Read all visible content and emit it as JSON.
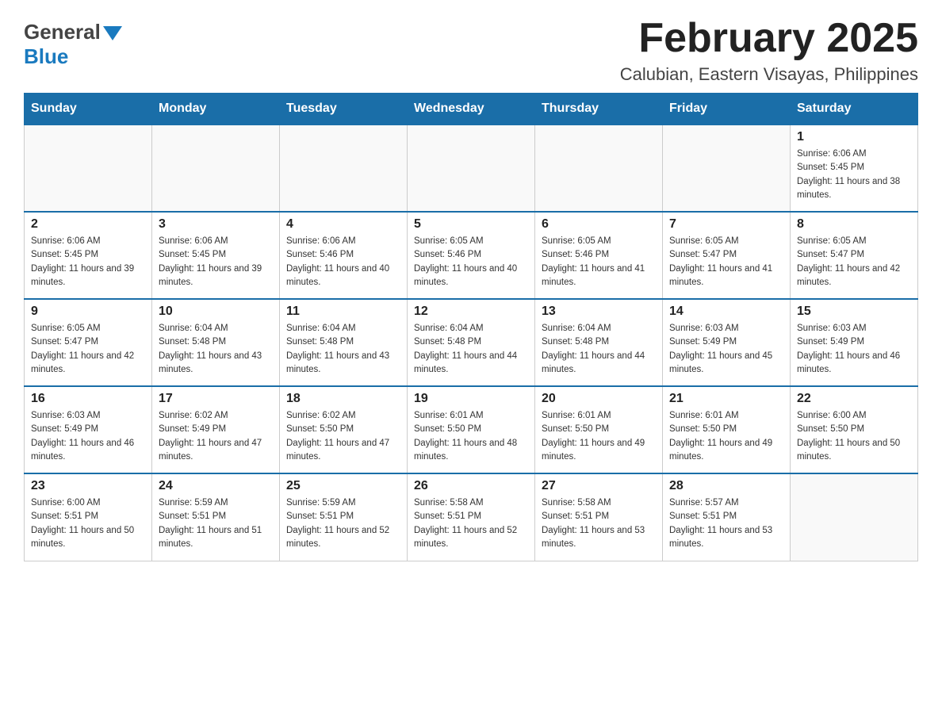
{
  "header": {
    "logo": {
      "general_text": "General",
      "blue_text": "Blue"
    },
    "title": "February 2025",
    "location": "Calubian, Eastern Visayas, Philippines"
  },
  "calendar": {
    "days_of_week": [
      "Sunday",
      "Monday",
      "Tuesday",
      "Wednesday",
      "Thursday",
      "Friday",
      "Saturday"
    ],
    "weeks": [
      [
        {
          "day": "",
          "info": ""
        },
        {
          "day": "",
          "info": ""
        },
        {
          "day": "",
          "info": ""
        },
        {
          "day": "",
          "info": ""
        },
        {
          "day": "",
          "info": ""
        },
        {
          "day": "",
          "info": ""
        },
        {
          "day": "1",
          "info": "Sunrise: 6:06 AM\nSunset: 5:45 PM\nDaylight: 11 hours and 38 minutes."
        }
      ],
      [
        {
          "day": "2",
          "info": "Sunrise: 6:06 AM\nSunset: 5:45 PM\nDaylight: 11 hours and 39 minutes."
        },
        {
          "day": "3",
          "info": "Sunrise: 6:06 AM\nSunset: 5:45 PM\nDaylight: 11 hours and 39 minutes."
        },
        {
          "day": "4",
          "info": "Sunrise: 6:06 AM\nSunset: 5:46 PM\nDaylight: 11 hours and 40 minutes."
        },
        {
          "day": "5",
          "info": "Sunrise: 6:05 AM\nSunset: 5:46 PM\nDaylight: 11 hours and 40 minutes."
        },
        {
          "day": "6",
          "info": "Sunrise: 6:05 AM\nSunset: 5:46 PM\nDaylight: 11 hours and 41 minutes."
        },
        {
          "day": "7",
          "info": "Sunrise: 6:05 AM\nSunset: 5:47 PM\nDaylight: 11 hours and 41 minutes."
        },
        {
          "day": "8",
          "info": "Sunrise: 6:05 AM\nSunset: 5:47 PM\nDaylight: 11 hours and 42 minutes."
        }
      ],
      [
        {
          "day": "9",
          "info": "Sunrise: 6:05 AM\nSunset: 5:47 PM\nDaylight: 11 hours and 42 minutes."
        },
        {
          "day": "10",
          "info": "Sunrise: 6:04 AM\nSunset: 5:48 PM\nDaylight: 11 hours and 43 minutes."
        },
        {
          "day": "11",
          "info": "Sunrise: 6:04 AM\nSunset: 5:48 PM\nDaylight: 11 hours and 43 minutes."
        },
        {
          "day": "12",
          "info": "Sunrise: 6:04 AM\nSunset: 5:48 PM\nDaylight: 11 hours and 44 minutes."
        },
        {
          "day": "13",
          "info": "Sunrise: 6:04 AM\nSunset: 5:48 PM\nDaylight: 11 hours and 44 minutes."
        },
        {
          "day": "14",
          "info": "Sunrise: 6:03 AM\nSunset: 5:49 PM\nDaylight: 11 hours and 45 minutes."
        },
        {
          "day": "15",
          "info": "Sunrise: 6:03 AM\nSunset: 5:49 PM\nDaylight: 11 hours and 46 minutes."
        }
      ],
      [
        {
          "day": "16",
          "info": "Sunrise: 6:03 AM\nSunset: 5:49 PM\nDaylight: 11 hours and 46 minutes."
        },
        {
          "day": "17",
          "info": "Sunrise: 6:02 AM\nSunset: 5:49 PM\nDaylight: 11 hours and 47 minutes."
        },
        {
          "day": "18",
          "info": "Sunrise: 6:02 AM\nSunset: 5:50 PM\nDaylight: 11 hours and 47 minutes."
        },
        {
          "day": "19",
          "info": "Sunrise: 6:01 AM\nSunset: 5:50 PM\nDaylight: 11 hours and 48 minutes."
        },
        {
          "day": "20",
          "info": "Sunrise: 6:01 AM\nSunset: 5:50 PM\nDaylight: 11 hours and 49 minutes."
        },
        {
          "day": "21",
          "info": "Sunrise: 6:01 AM\nSunset: 5:50 PM\nDaylight: 11 hours and 49 minutes."
        },
        {
          "day": "22",
          "info": "Sunrise: 6:00 AM\nSunset: 5:50 PM\nDaylight: 11 hours and 50 minutes."
        }
      ],
      [
        {
          "day": "23",
          "info": "Sunrise: 6:00 AM\nSunset: 5:51 PM\nDaylight: 11 hours and 50 minutes."
        },
        {
          "day": "24",
          "info": "Sunrise: 5:59 AM\nSunset: 5:51 PM\nDaylight: 11 hours and 51 minutes."
        },
        {
          "day": "25",
          "info": "Sunrise: 5:59 AM\nSunset: 5:51 PM\nDaylight: 11 hours and 52 minutes."
        },
        {
          "day": "26",
          "info": "Sunrise: 5:58 AM\nSunset: 5:51 PM\nDaylight: 11 hours and 52 minutes."
        },
        {
          "day": "27",
          "info": "Sunrise: 5:58 AM\nSunset: 5:51 PM\nDaylight: 11 hours and 53 minutes."
        },
        {
          "day": "28",
          "info": "Sunrise: 5:57 AM\nSunset: 5:51 PM\nDaylight: 11 hours and 53 minutes."
        },
        {
          "day": "",
          "info": ""
        }
      ]
    ]
  }
}
